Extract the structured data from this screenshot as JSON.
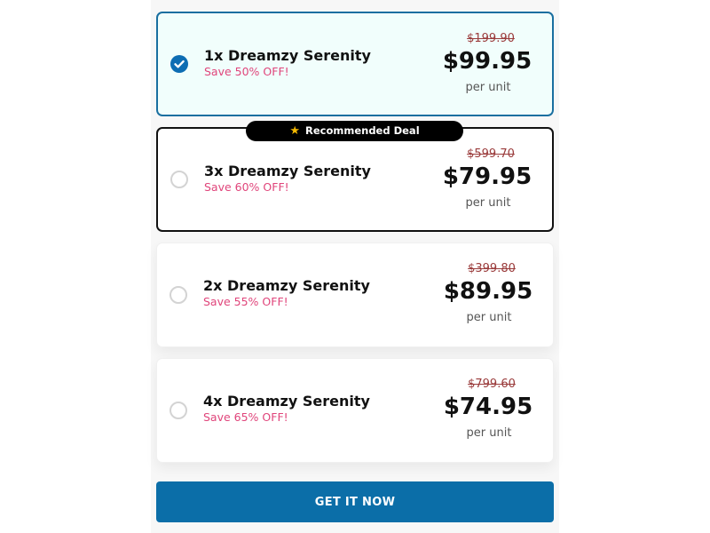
{
  "offers": [
    {
      "name": "1x Dreamzy Serenity",
      "savings": "Save 50% OFF!",
      "original_price": "$199.90",
      "price": "$99.95",
      "unit": "per unit",
      "selected": true
    },
    {
      "name": "3x Dreamzy Serenity",
      "savings": "Save 60% OFF!",
      "original_price": "$599.70",
      "price": "$79.95",
      "unit": "per unit",
      "selected": false,
      "badge": "Recommended Deal"
    },
    {
      "name": "2x Dreamzy Serenity",
      "savings": "Save 55% OFF!",
      "original_price": "$399.80",
      "price": "$89.95",
      "unit": "per unit",
      "selected": false
    },
    {
      "name": "4x Dreamzy Serenity",
      "savings": "Save 65% OFF!",
      "original_price": "$799.60",
      "price": "$74.95",
      "unit": "per unit",
      "selected": false
    }
  ],
  "badge_icon": "star-icon",
  "cta": {
    "label": "GET IT NOW"
  },
  "colors": {
    "accent": "#0b6ea8",
    "savings": "#e0457b",
    "selected_bg": "#f1fefc"
  }
}
